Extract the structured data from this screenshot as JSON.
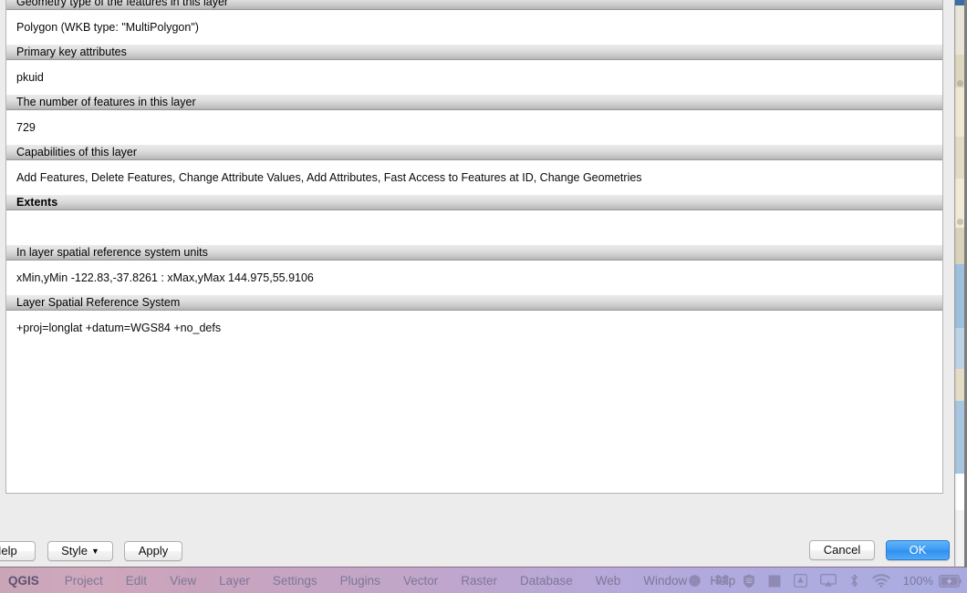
{
  "dialog": {
    "metadata_rows": [
      {
        "header": "Geometry type of the features in this layer",
        "bold": false,
        "value": "Polygon (WKB type: \"MultiPolygon\")"
      },
      {
        "header": "Primary key attributes",
        "bold": false,
        "value": "pkuid"
      },
      {
        "header": "The number of features in this layer",
        "bold": false,
        "value": "729"
      },
      {
        "header": "Capabilities of this layer",
        "bold": false,
        "value": "Add Features, Delete Features, Change Attribute Values, Add Attributes, Fast Access to Features at ID, Change Geometries"
      },
      {
        "header": "Extents",
        "bold": true,
        "value": ""
      },
      {
        "header": "In layer spatial reference system units",
        "bold": false,
        "value": "xMin,yMin -122.83,-37.8261 : xMax,yMax 144.975,55.9106"
      },
      {
        "header": "Layer Spatial Reference System",
        "bold": false,
        "value": "+proj=longlat +datum=WGS84 +no_defs"
      }
    ],
    "buttons": {
      "help": "Help",
      "style": "Style",
      "style_caret": "▼",
      "apply": "Apply",
      "cancel": "Cancel",
      "ok": "OK"
    }
  },
  "menubar": {
    "app_name": "QGIS",
    "items": [
      "Project",
      "Edit",
      "View",
      "Layer",
      "Settings",
      "Plugins",
      "Vector",
      "Raster",
      "Database",
      "Web",
      "Window",
      "Help"
    ],
    "status_icons": [
      "circle-icon",
      "dropbox-icon",
      "shield-icon",
      "square-icon",
      "google-drive-icon",
      "airplay-icon",
      "bluetooth-icon",
      "wifi-icon"
    ],
    "battery_percent": "100%"
  },
  "colors": {
    "accent_ok_button": "#3d9bf3",
    "header_gradient_top": "#ebebeb",
    "header_gradient_bottom": "#b4b4b4",
    "menubar_left": "#c9a5b8",
    "menubar_right": "#a9abe0"
  }
}
